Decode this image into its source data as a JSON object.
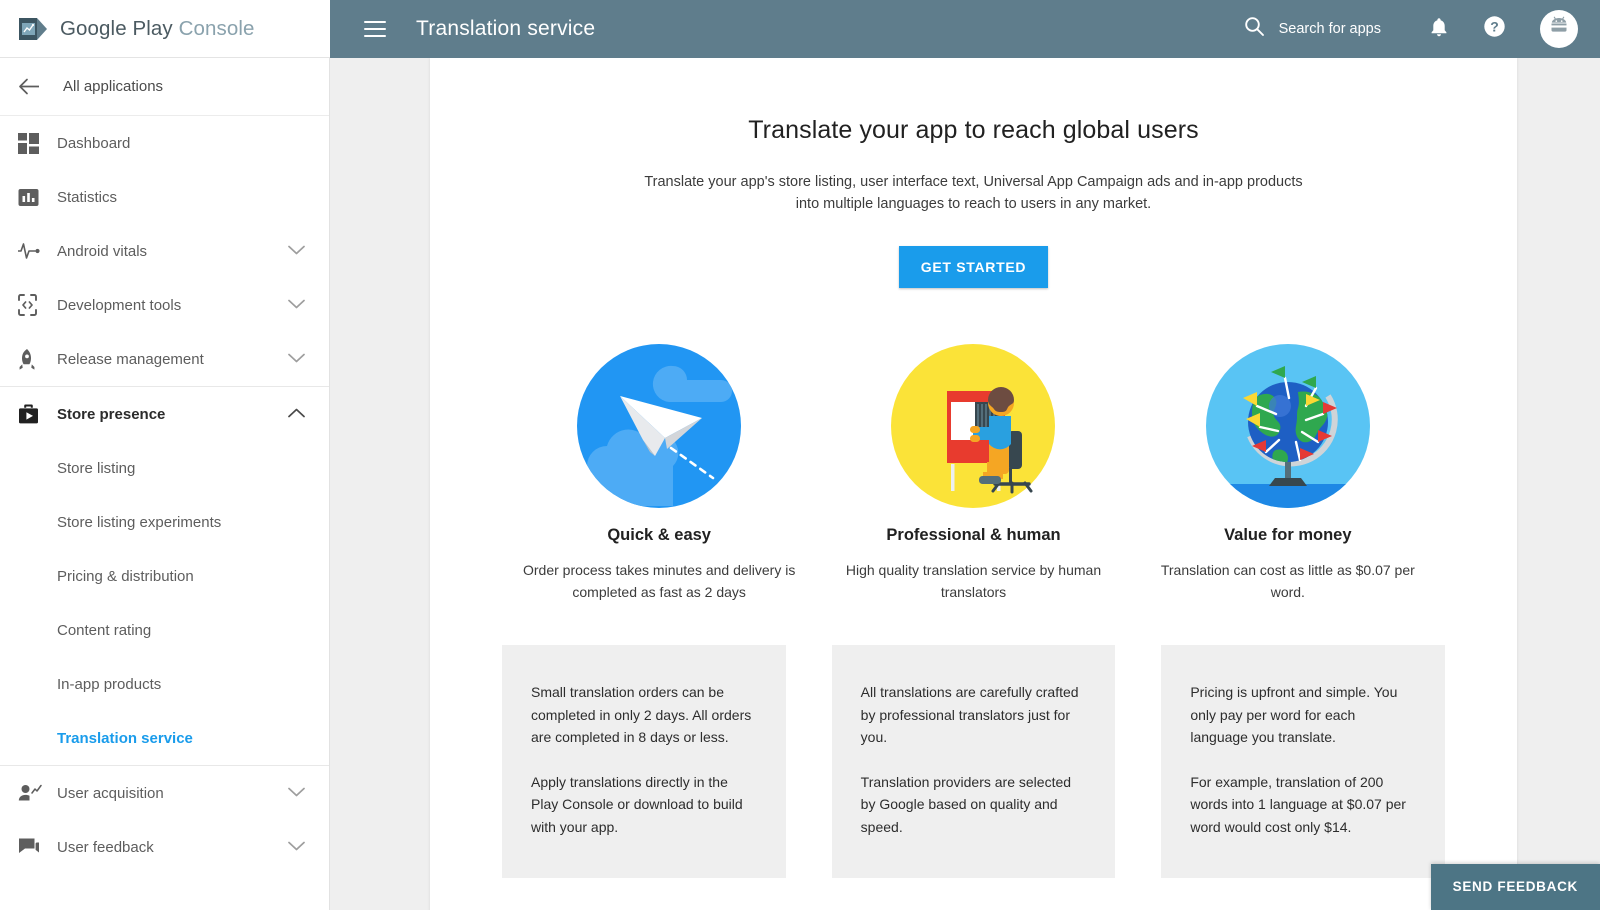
{
  "brand": {
    "name_bold": "Google Play",
    "name_light": "Console",
    "logo_icon": "play-console-logo"
  },
  "topbar": {
    "menu_icon": "hamburger-menu-icon",
    "title": "Translation service",
    "search_label": "Search for apps",
    "search_icon": "search-icon",
    "notifications_icon": "bell-icon",
    "help_icon": "help-circle-icon",
    "avatar_icon": "android-avatar-icon",
    "background": "#5f7d8c"
  },
  "sidebar": {
    "back": {
      "label": "All applications",
      "icon": "arrow-left-icon"
    },
    "items": [
      {
        "label": "Dashboard",
        "icon": "dashboard-icon",
        "expandable": false
      },
      {
        "label": "Statistics",
        "icon": "bar-chart-icon",
        "expandable": false
      },
      {
        "label": "Android vitals",
        "icon": "pulse-icon",
        "expandable": true
      },
      {
        "label": "Development tools",
        "icon": "code-brackets-icon",
        "expandable": true
      },
      {
        "label": "Release management",
        "icon": "rocket-icon",
        "expandable": true
      }
    ],
    "store_presence": {
      "label": "Store presence",
      "icon": "store-briefcase-icon",
      "expanded": true,
      "chevron_icon": "chevron-up-icon",
      "children": [
        {
          "label": "Store listing",
          "selected": false
        },
        {
          "label": "Store listing experiments",
          "selected": false
        },
        {
          "label": "Pricing & distribution",
          "selected": false
        },
        {
          "label": "Content rating",
          "selected": false
        },
        {
          "label": "In-app products",
          "selected": false
        },
        {
          "label": "Translation service",
          "selected": true
        }
      ]
    },
    "bottom_items": [
      {
        "label": "User acquisition",
        "icon": "user-trend-icon",
        "expandable": true
      },
      {
        "label": "User feedback",
        "icon": "chat-bubbles-icon",
        "expandable": true
      }
    ],
    "selected_color": "#1a9ceb"
  },
  "main": {
    "heading": "Translate your app to reach global users",
    "subheading": "Translate your app's store listing, user interface text, Universal App Campaign ads and in-app products into multiple languages to reach to users in any market.",
    "cta_label": "GET STARTED",
    "cta_color": "#1a9ceb",
    "features": [
      {
        "icon": "paper-plane-icon",
        "title": "Quick & easy",
        "desc": "Order process takes minutes and delivery is completed as fast as 2 days"
      },
      {
        "icon": "person-at-desk-icon",
        "title": "Professional & human",
        "desc": "High quality translation service by human translators"
      },
      {
        "icon": "globe-with-flags-icon",
        "title": "Value for money",
        "desc": "Translation can cost as little as $0.07 per word."
      }
    ],
    "panels": [
      {
        "p1": "Small translation orders can be completed in only 2 days. All orders are completed in 8 days or less.",
        "p2": "Apply translations directly in the Play Console or download to build with your app."
      },
      {
        "p1": "All translations are carefully crafted by professional translators just for you.",
        "p2": "Translation providers are selected by Google based on quality and speed."
      },
      {
        "p1": "Pricing is upfront and simple. You only pay per word for each language you translate.",
        "p2": "For example, translation of 200 words into 1 language at $0.07 per word would cost only $14."
      }
    ]
  },
  "feedback": {
    "label": "SEND FEEDBACK",
    "color": "#4d7585"
  }
}
